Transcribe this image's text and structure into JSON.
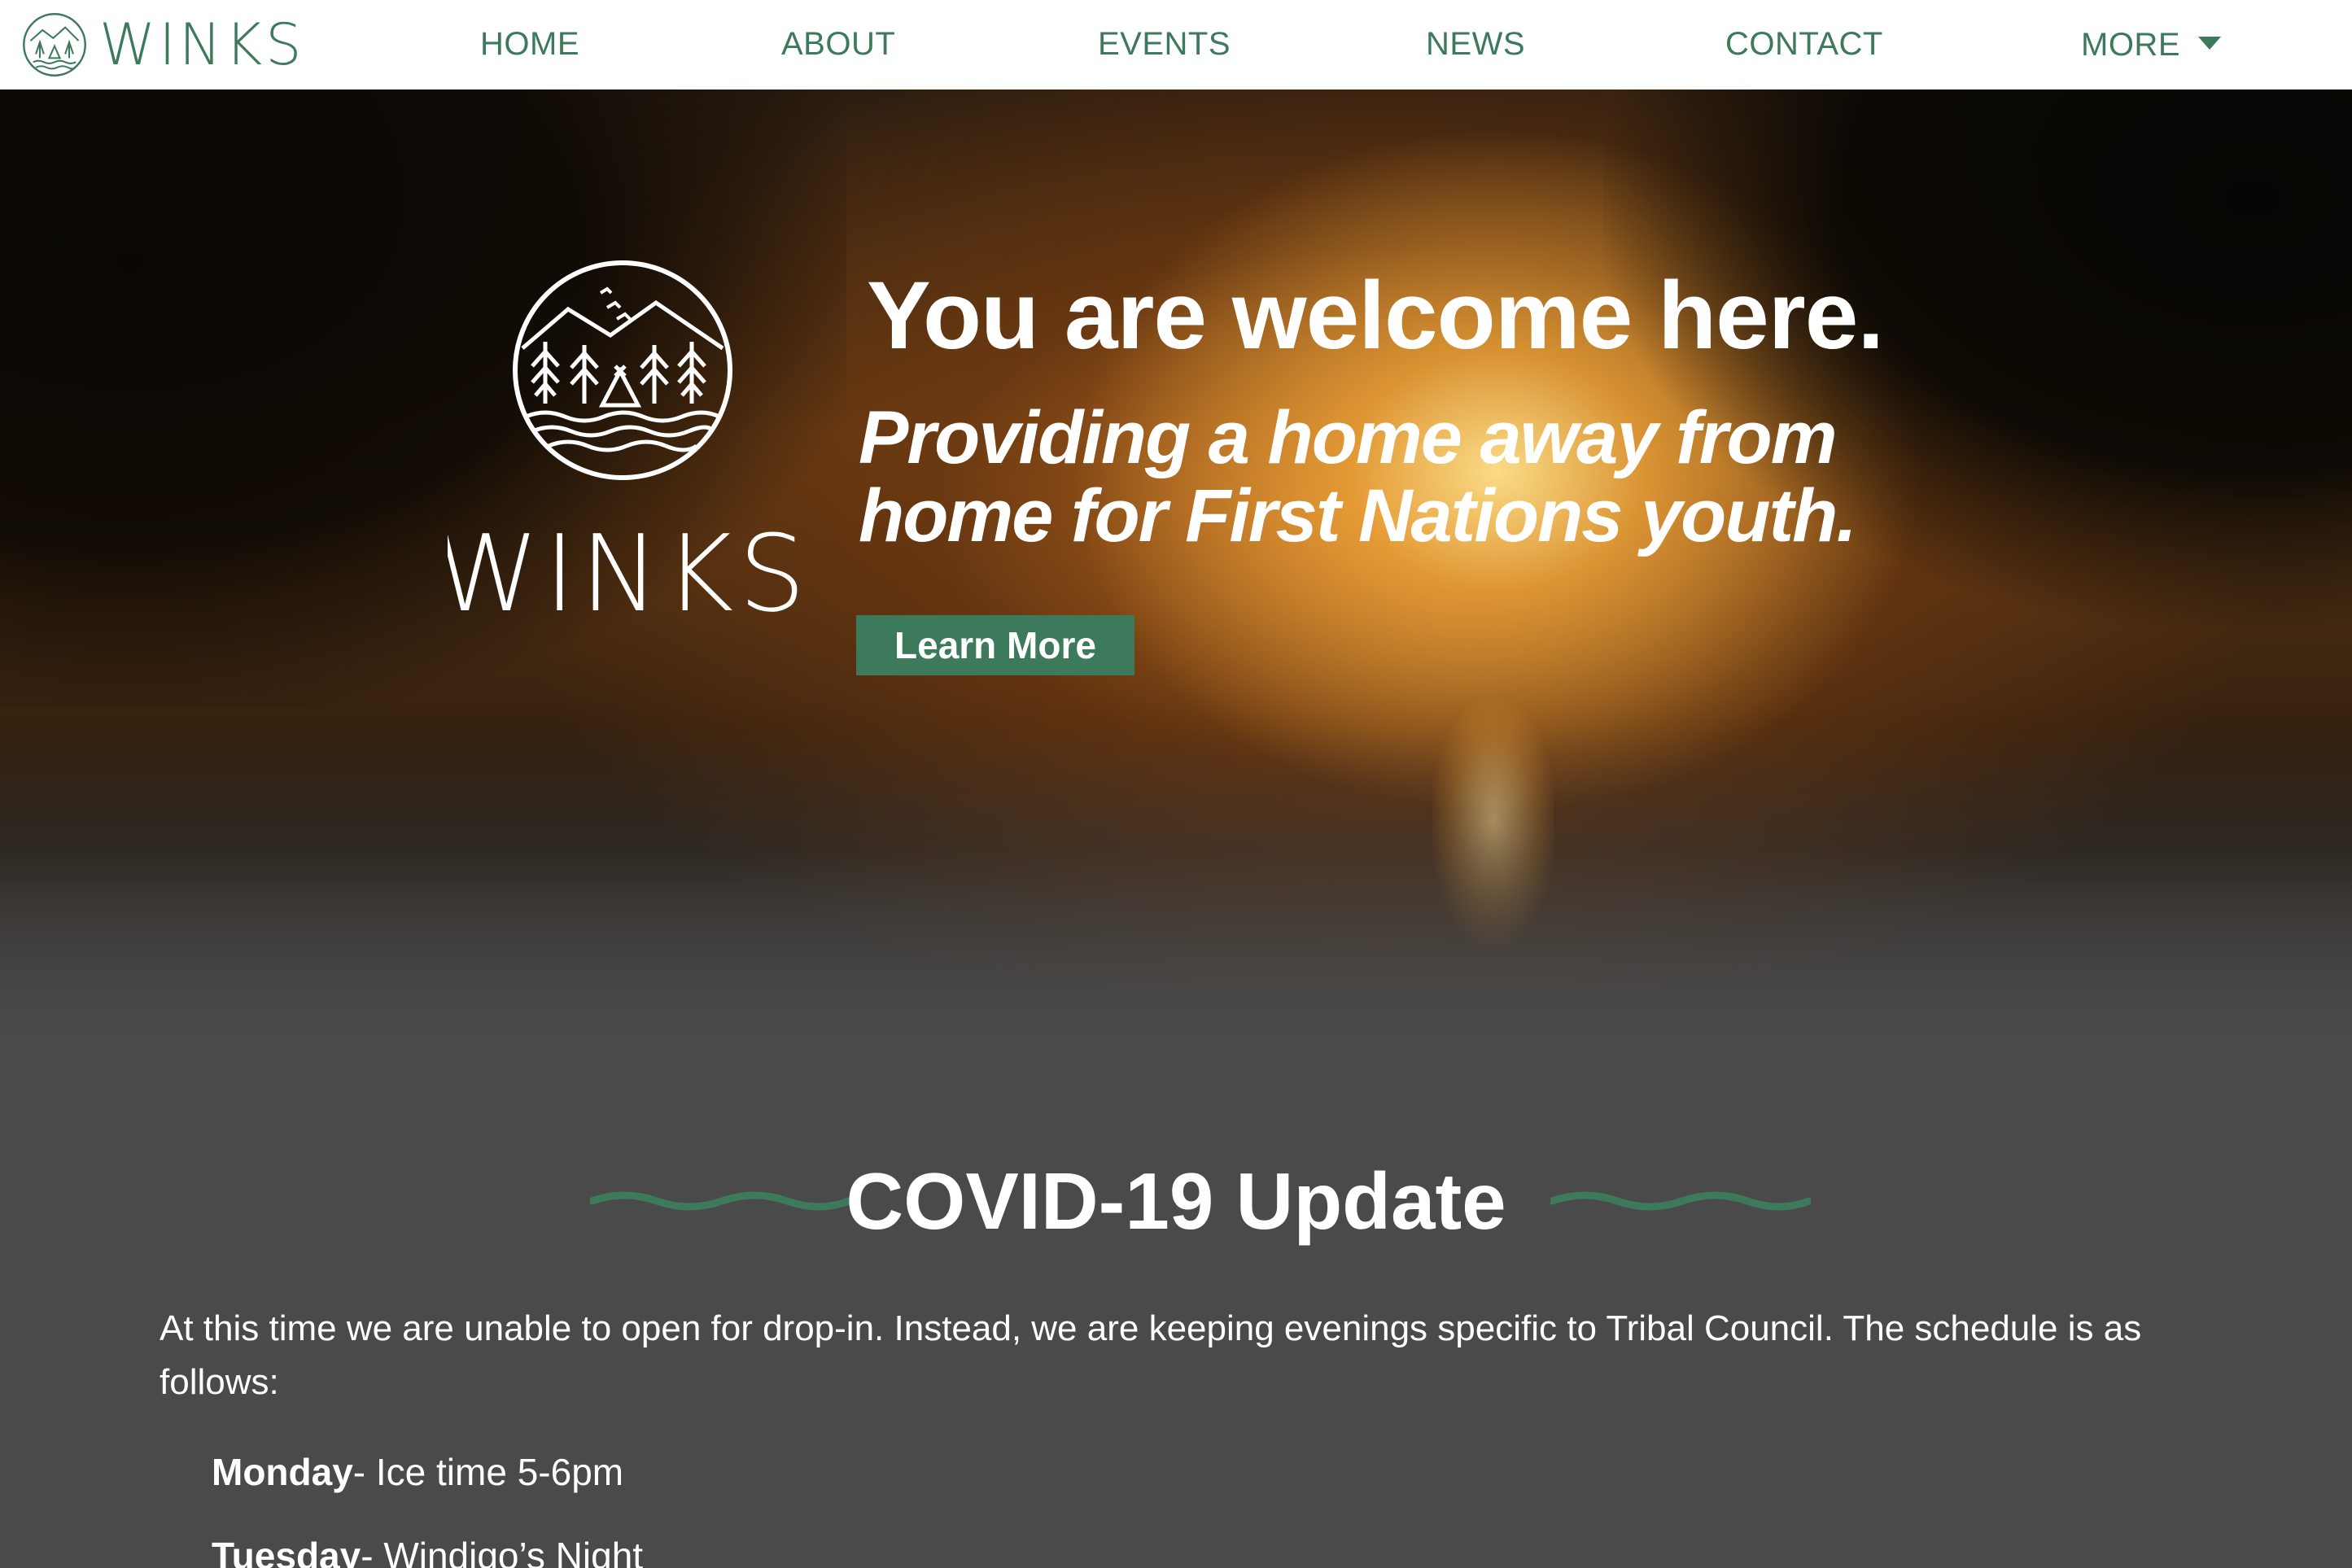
{
  "brand": {
    "name": "WINKS",
    "logo_icon": "winks-emblem-icon"
  },
  "nav": {
    "items": [
      {
        "label": "HOME"
      },
      {
        "label": "ABOUT"
      },
      {
        "label": "EVENTS"
      },
      {
        "label": "NEWS"
      },
      {
        "label": "CONTACT"
      },
      {
        "label": "MORE",
        "icon": "caret-down-icon"
      }
    ]
  },
  "hero": {
    "logo_text": "WINKS",
    "title": "You are welcome here.",
    "subtitle_line1": "Providing a home away from",
    "subtitle_line2": "home for First Nations youth.",
    "button_label": "Learn More"
  },
  "covid": {
    "title": "COVID-19 Update",
    "intro": "At this time we are unable to open for drop-in. Instead, we are keeping evenings specific to Tribal Council. The schedule is as follows:",
    "schedule": [
      {
        "day": "Monday",
        "detail": "- Ice time 5-6pm"
      },
      {
        "day": "Tuesday",
        "detail": "- Windigo’s Night"
      }
    ]
  },
  "colors": {
    "accent": "#3d7a5c",
    "background": "#4a4a4a",
    "nav_bg": "#ffffff"
  }
}
